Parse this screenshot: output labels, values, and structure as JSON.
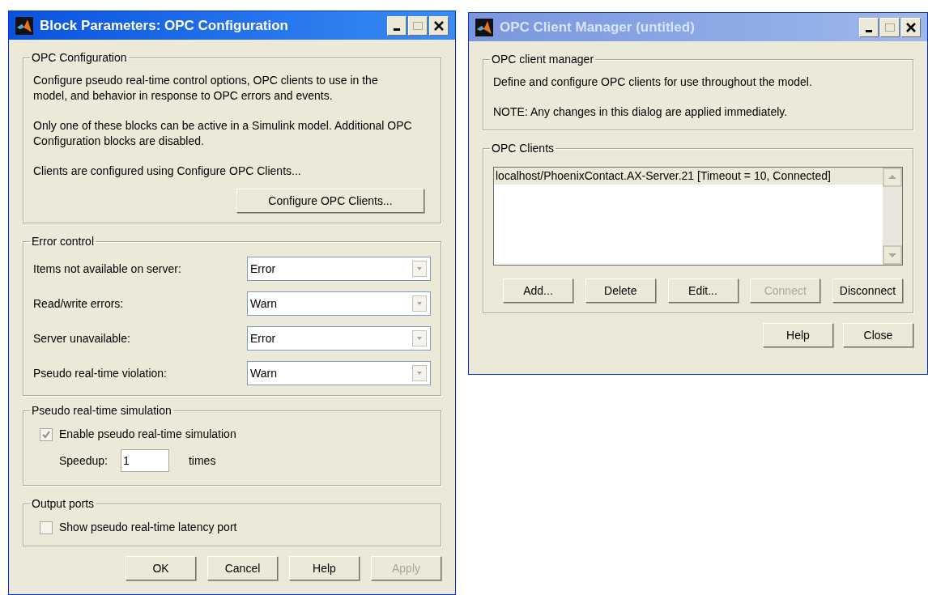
{
  "windows": [
    {
      "title": "Block Parameters: OPC Configuration",
      "active": true,
      "kind": "block",
      "groups": [
        {
          "kind": "text",
          "title": "OPC Configuration",
          "paragraphs": [
            "Configure pseudo real-time control options, OPC clients to use in the model, and behavior in response to OPC errors and events.",
            "Only one of these blocks can be active in a Simulink model. Additional OPC Configuration blocks are disabled.",
            "Clients are configured using Configure OPC Clients..."
          ],
          "button": {
            "label": "Configure OPC Clients...",
            "disabled": false
          }
        },
        {
          "kind": "dropdowns",
          "title": "Error control",
          "fields": [
            {
              "label": "Items not available on server:",
              "value": "Error"
            },
            {
              "label": "Read/write errors:",
              "value": "Warn"
            },
            {
              "label": "Server unavailable:",
              "value": "Error"
            },
            {
              "label": "Pseudo real-time violation:",
              "value": "Warn"
            }
          ]
        },
        {
          "kind": "checkbox",
          "title": "Pseudo real-time simulation",
          "checkbox": {
            "label": "Enable pseudo real-time simulation",
            "checked": true
          },
          "input": {
            "label": "Speedup:",
            "value": "1",
            "unit": "times"
          }
        },
        {
          "kind": "checkbox",
          "title": "Output ports",
          "checkbox": {
            "label": "Show pseudo real-time latency port",
            "checked": false
          }
        }
      ],
      "buttons": [
        {
          "label": "OK",
          "disabled": false
        },
        {
          "label": "Cancel",
          "disabled": false
        },
        {
          "label": "Help",
          "disabled": false
        },
        {
          "label": "Apply",
          "disabled": true
        }
      ]
    },
    {
      "title": "OPC Client Manager (untitled)",
      "active": false,
      "kind": "manager",
      "groups": [
        {
          "kind": "text",
          "title": "OPC client manager",
          "paragraphs": [
            "Define and configure OPC clients for use throughout the model.",
            "NOTE: Any changes in this dialog are applied immediately."
          ]
        },
        {
          "kind": "list",
          "title": "OPC Clients",
          "items": [
            {
              "label": "localhost/PhoenixContact.AX-Server.21 [Timeout = 10, Connected]",
              "selected": true
            }
          ],
          "list_buttons": [
            {
              "label": "Add...",
              "disabled": false
            },
            {
              "label": "Delete",
              "disabled": false
            },
            {
              "label": "Edit...",
              "disabled": false
            },
            {
              "label": "Connect",
              "disabled": true
            },
            {
              "label": "Disconnect",
              "disabled": false
            }
          ]
        }
      ],
      "buttons": [
        {
          "label": "Help",
          "disabled": false
        },
        {
          "label": "Close",
          "disabled": false
        }
      ]
    }
  ]
}
